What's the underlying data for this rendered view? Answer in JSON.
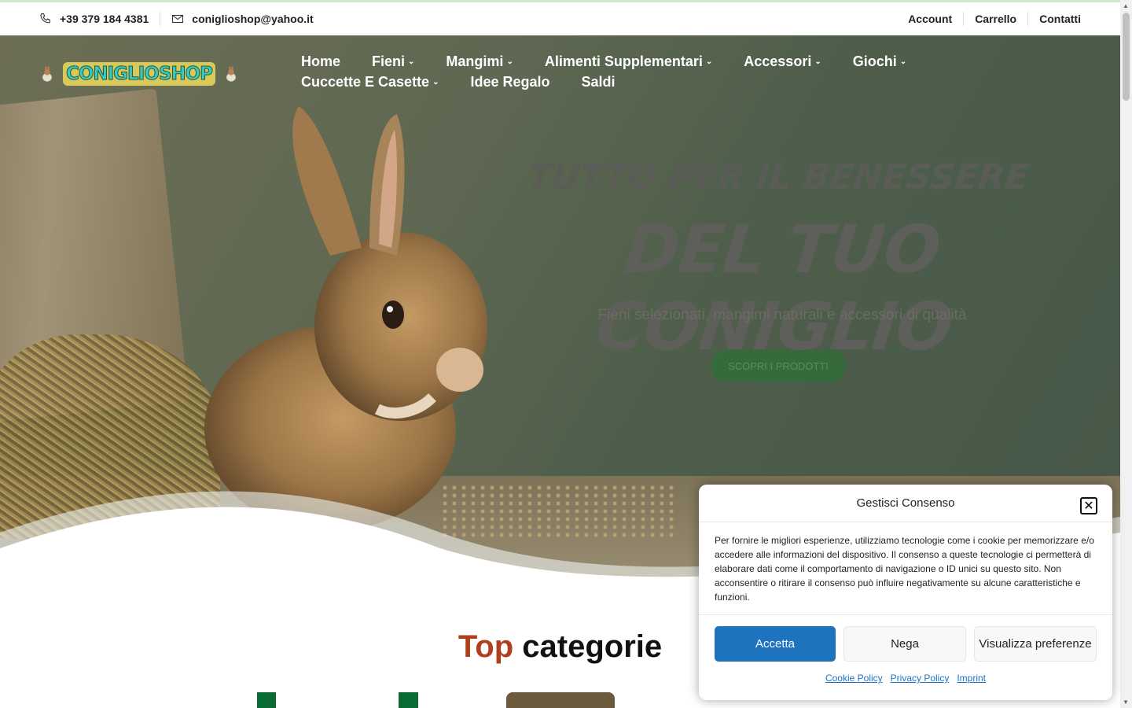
{
  "topbar": {
    "phone": "+39 379 184 4381",
    "email": "coniglioshop@yahoo.it",
    "links": [
      "Account",
      "Carrello",
      "Contatti"
    ]
  },
  "logo": {
    "text": "CONIGLIOSHOP"
  },
  "nav": {
    "items": [
      {
        "label": "Home",
        "has_dropdown": false
      },
      {
        "label": "Fieni",
        "has_dropdown": true
      },
      {
        "label": "Mangimi",
        "has_dropdown": true
      },
      {
        "label": "Alimenti Supplementari",
        "has_dropdown": true
      },
      {
        "label": "Accessori",
        "has_dropdown": true
      },
      {
        "label": "Giochi",
        "has_dropdown": true
      },
      {
        "label": "Cuccette E Casette",
        "has_dropdown": true
      },
      {
        "label": "Idee Regalo",
        "has_dropdown": false
      },
      {
        "label": "Saldi",
        "has_dropdown": false
      }
    ]
  },
  "hero": {
    "title_line1": "TUTTO PER IL BENESSERE",
    "title_line2": "DEL TUO CONIGLIO",
    "subtitle": "Fieni selezionati, mangimi naturali e accessori di qualità",
    "cta": "SCOPRI I PRODOTTI"
  },
  "section": {
    "title_accent": "Top",
    "title_rest": "categorie"
  },
  "consent": {
    "title": "Gestisci Consenso",
    "body": "Per fornire le migliori esperienze, utilizziamo tecnologie come i cookie per memorizzare e/o accedere alle informazioni del dispositivo. Il consenso a queste tecnologie ci permetterà di elaborare dati come il comportamento di navigazione o ID unici su questo sito. Non acconsentire o ritirare il consenso può influire negativamente su alcune caratteristiche e funzioni.",
    "accept": "Accetta",
    "deny": "Nega",
    "preferences": "Visualizza preferenze",
    "links": [
      "Cookie Policy",
      "Privacy Policy",
      "Imprint"
    ]
  },
  "colors": {
    "accent_blue": "#1e73be",
    "accent_red": "#b03f1d",
    "cta_green": "#356b3a"
  }
}
